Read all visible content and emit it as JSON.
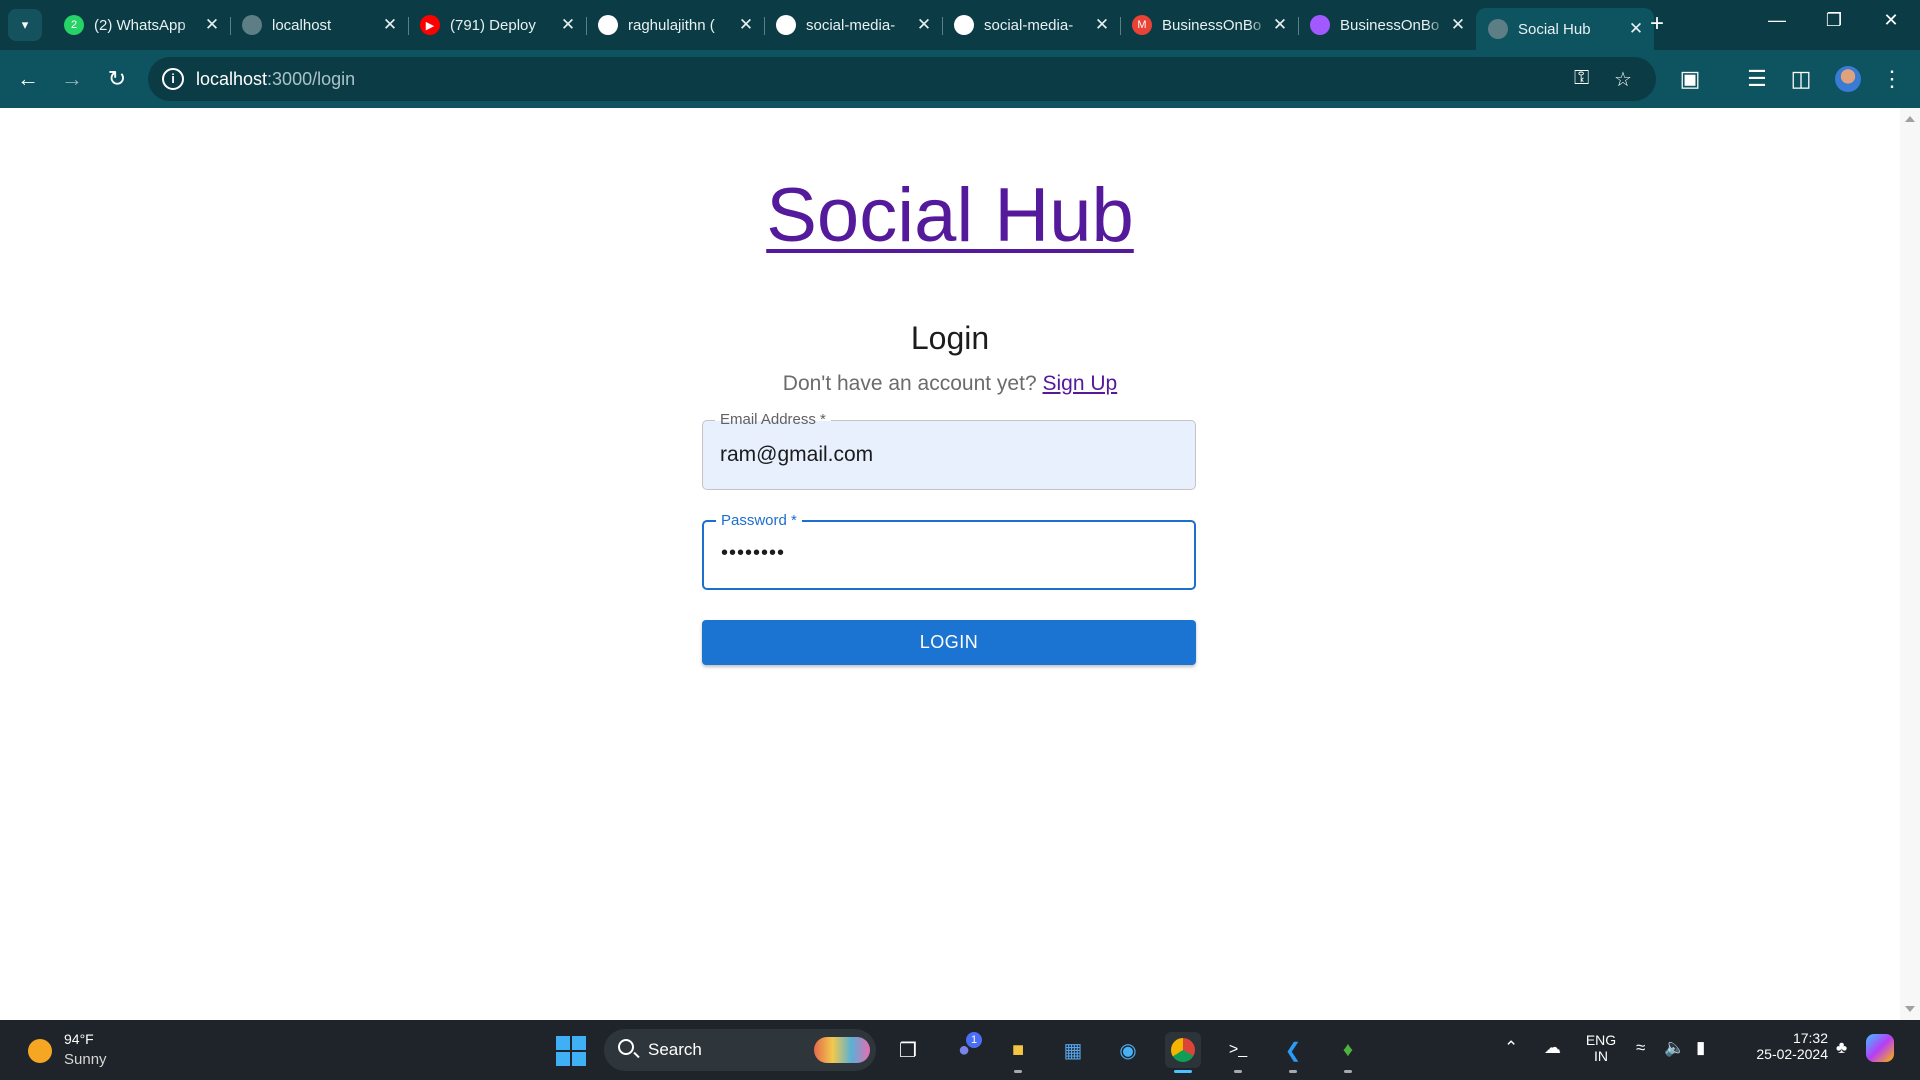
{
  "browser": {
    "tabs": [
      {
        "title": "(2) WhatsApp",
        "favicon": "whatsapp-icon",
        "favicon_color": "#25d366",
        "favicon_text": "2"
      },
      {
        "title": "localhost",
        "favicon": "globe-icon",
        "favicon_color": "#5e7e86",
        "favicon_text": ""
      },
      {
        "title": "(791) Deploy",
        "favicon": "youtube-icon",
        "favicon_color": "#ff0000",
        "favicon_text": "▶"
      },
      {
        "title": "raghulajithn (",
        "favicon": "github-icon",
        "favicon_color": "#ffffff",
        "favicon_text": ""
      },
      {
        "title": "social-media-",
        "favicon": "render-icon",
        "favicon_color": "#ffffff",
        "favicon_text": ""
      },
      {
        "title": "social-media-",
        "favicon": "render-icon",
        "favicon_color": "#ffffff",
        "favicon_text": ""
      },
      {
        "title": "BusinessOnBo",
        "favicon": "gmail-icon",
        "favicon_color": "#ea4335",
        "favicon_text": "M"
      },
      {
        "title": "BusinessOnBo",
        "favicon": "figma-icon",
        "favicon_color": "#a259ff",
        "favicon_text": ""
      },
      {
        "title": "Social Hub",
        "favicon": "globe-icon",
        "favicon_color": "#5e7e86",
        "favicon_text": "",
        "active": true
      }
    ],
    "url_host": "localhost",
    "url_path": ":3000/login"
  },
  "page": {
    "brand": "Social Hub",
    "title": "Login",
    "signup_prompt": "Don't have an account yet?",
    "signup_link": "Sign Up",
    "email_label": "Email Address *",
    "email_value": "ram@gmail.com",
    "password_label": "Password *",
    "password_value": "••••••••",
    "login_button": "LOGIN"
  },
  "taskbar": {
    "temperature": "94°F",
    "weather": "Sunny",
    "search_label": "Search",
    "chat_badge": "1",
    "lang_top": "ENG",
    "lang_bottom": "IN",
    "time": "17:32",
    "date": "25-02-2024"
  },
  "colors": {
    "tabstrip": "#0b3b44",
    "toolbar": "#0e5360",
    "brand_link": "#55199b",
    "login_button": "#1b74d2",
    "focus_border": "#1b6fcf"
  }
}
